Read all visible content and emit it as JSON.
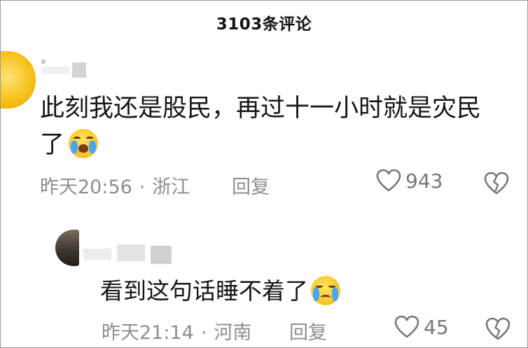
{
  "header": {
    "title": "3103条评论"
  },
  "comments": [
    {
      "text": "此刻我还是股民，再过十一小时就是灾民了",
      "emoji": "crying-laughing-face-icon",
      "time": "昨天20:56",
      "separator": "·",
      "location": "浙江",
      "reply_label": "回复",
      "likes": "943"
    },
    {
      "text": "看到这句话睡不着了",
      "emoji": "crying-face-icon",
      "time": "昨天21:14",
      "separator": "·",
      "location": "河南",
      "reply_label": "回复",
      "likes": "45"
    }
  ],
  "colors": {
    "meta_text": "#8e8e8e",
    "primary_text": "#161616",
    "icon_stroke": "#777777"
  }
}
